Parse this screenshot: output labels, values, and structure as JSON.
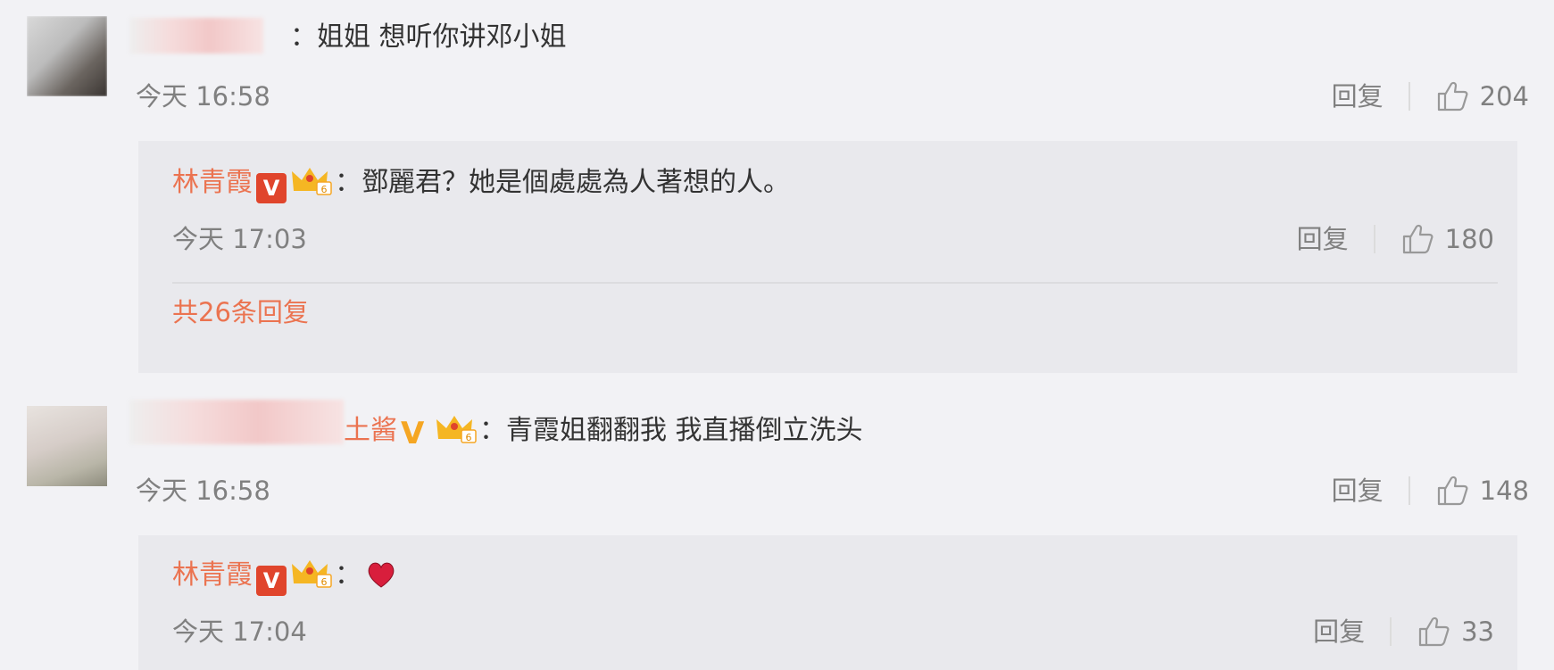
{
  "comments": [
    {
      "text": "：姐姐 想听你讲邓小姐",
      "time": "今天 16:58",
      "reply_label": "回复",
      "likes": "204",
      "reply": {
        "username": "林青霞",
        "text": "：鄧麗君？她是個處處為人著想的人。",
        "time": "今天 17:03",
        "reply_label": "回复",
        "likes": "180",
        "more": "共26条回复"
      }
    },
    {
      "name_suffix": "土酱",
      "text": "：青霞姐翻翻我 我直播倒立洗头",
      "time": "今天 16:58",
      "reply_label": "回复",
      "likes": "148",
      "reply": {
        "username": "林青霞",
        "text": "：",
        "time": "今天 17:04",
        "reply_label": "回复",
        "likes": "33"
      }
    }
  ],
  "colors": {
    "accent": "#eb7350",
    "background": "#f2f2f5",
    "reply_background": "#e9e9ed",
    "muted": "#808080"
  },
  "icons": {
    "verified": "verified-v-icon",
    "member": "crown-member-icon",
    "like": "thumbs-up-icon",
    "heart": "heart-icon"
  }
}
